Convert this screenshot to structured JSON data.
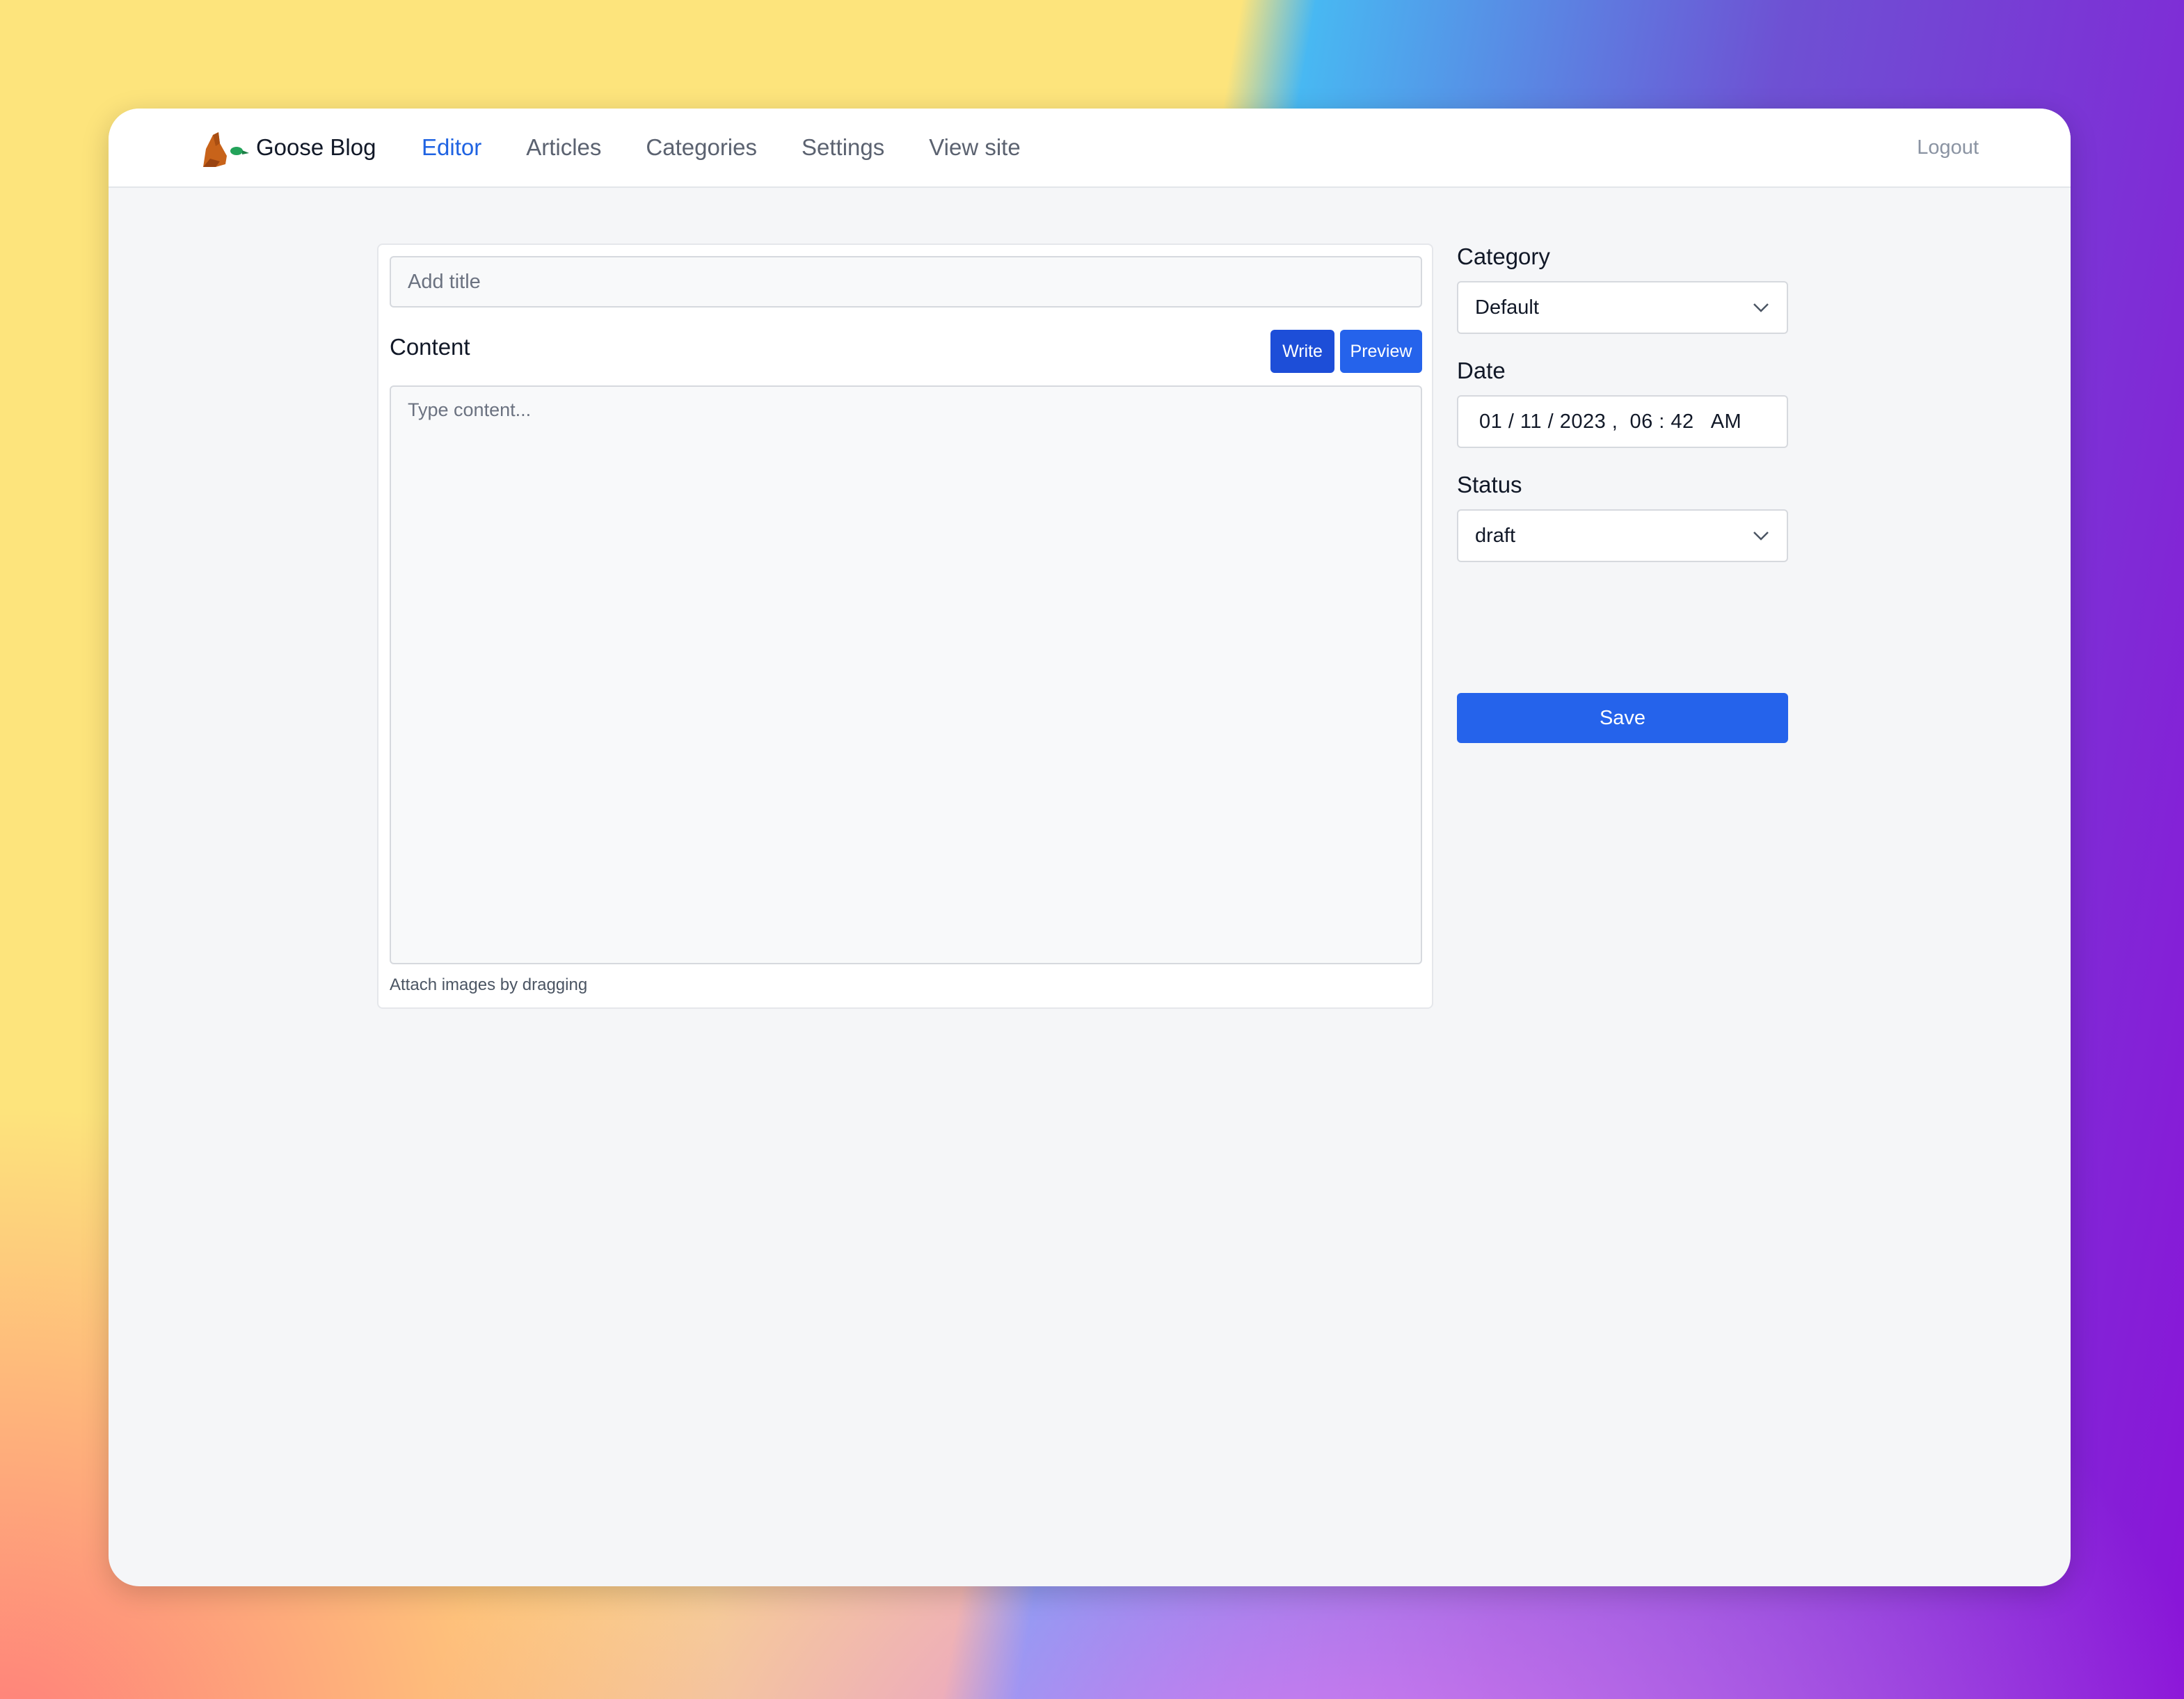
{
  "app": {
    "brand_name": "Goose Blog",
    "logo_icon": "goose-logo-icon"
  },
  "nav": {
    "items": [
      {
        "label": "Editor",
        "active": true
      },
      {
        "label": "Articles",
        "active": false
      },
      {
        "label": "Categories",
        "active": false
      },
      {
        "label": "Settings",
        "active": false
      },
      {
        "label": "View site",
        "active": false
      }
    ],
    "logout_label": "Logout"
  },
  "editor": {
    "title_value": "",
    "title_placeholder": "Add title",
    "content_label": "Content",
    "write_label": "Write",
    "preview_label": "Preview",
    "content_value": "",
    "content_placeholder": "Type content...",
    "attach_hint": "Attach images by dragging"
  },
  "sidebar": {
    "category_label": "Category",
    "category_value": "Default",
    "date_label": "Date",
    "date_value": "01 / 11 / 2023 ,  06 : 42   AM",
    "status_label": "Status",
    "status_value": "draft",
    "save_label": "Save"
  },
  "colors": {
    "accent": "#2563eb",
    "active_nav": "#1f63e2",
    "write_button": "#1d4ed8"
  }
}
